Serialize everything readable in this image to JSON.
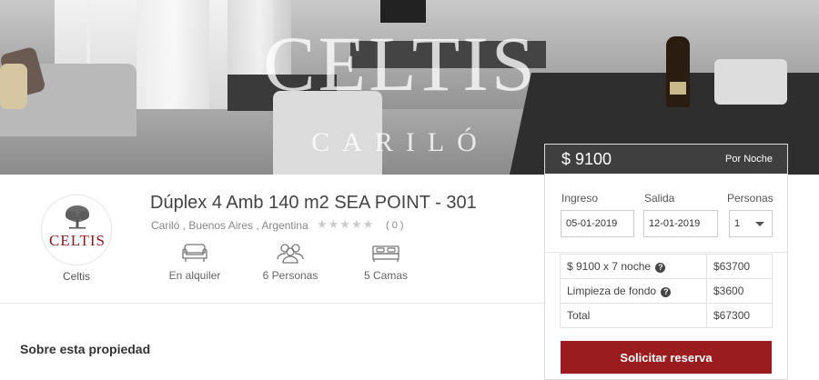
{
  "hero": {
    "brand_name": "CELTIS",
    "brand_location": "CARILÓ"
  },
  "host": {
    "logo_text": "CELTIS",
    "caption": "Celtis"
  },
  "property": {
    "title": "Dúplex 4 Amb 140 m2 SEA POINT - 301",
    "location": "Cariló , Buenos Aires , Argentina",
    "stars": "★★★★★",
    "reviews": "( 0 )"
  },
  "features": [
    {
      "icon": "armchair-icon",
      "label": "En alquiler"
    },
    {
      "icon": "people-icon",
      "label": "6 Personas"
    },
    {
      "icon": "bed-icon",
      "label": "5 Camas"
    }
  ],
  "about": {
    "heading": "Sobre esta propiedad"
  },
  "booking": {
    "price": "$ 9100",
    "price_unit": "Por Noche",
    "checkin_label": "Ingreso",
    "checkin_value": "05-01-2019",
    "checkout_label": "Salida",
    "checkout_value": "12-01-2019",
    "guests_label": "Personas",
    "guests_value": "1",
    "costs": [
      {
        "label": "$ 9100 x 7 noche",
        "amount": "$63700",
        "info": "?"
      },
      {
        "label": "Limpieza de fondo",
        "amount": "$3600",
        "info": "?"
      },
      {
        "label": "Total",
        "amount": "$67300"
      }
    ],
    "reserve_label": "Solicitar reserva"
  },
  "colors": {
    "accent": "#9b1c1f",
    "panel_header": "#3f3f3f"
  }
}
